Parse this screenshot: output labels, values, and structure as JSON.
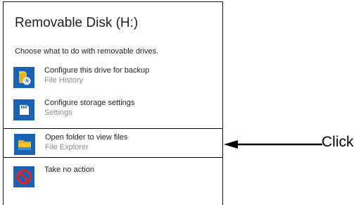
{
  "dialog": {
    "title": "Removable Disk (H:)",
    "prompt": "Choose what to do with removable drives.",
    "options": [
      {
        "label": "Configure this drive for backup",
        "sub": "File History",
        "icon": "file-history-icon"
      },
      {
        "label": "Configure storage settings",
        "sub": "Settings",
        "icon": "sd-card-settings-icon"
      },
      {
        "label": "Open folder to view files",
        "sub": "File Explorer",
        "icon": "file-explorer-folder-icon"
      },
      {
        "label": "Take no action",
        "sub": "",
        "icon": "no-action-icon"
      }
    ]
  },
  "annotation": {
    "text": "Click",
    "target": "Open folder to view files"
  },
  "colors": {
    "tile_blue": "#1a63b4",
    "folder_yellow": "#f4c431",
    "stop_red": "#d9262b"
  }
}
